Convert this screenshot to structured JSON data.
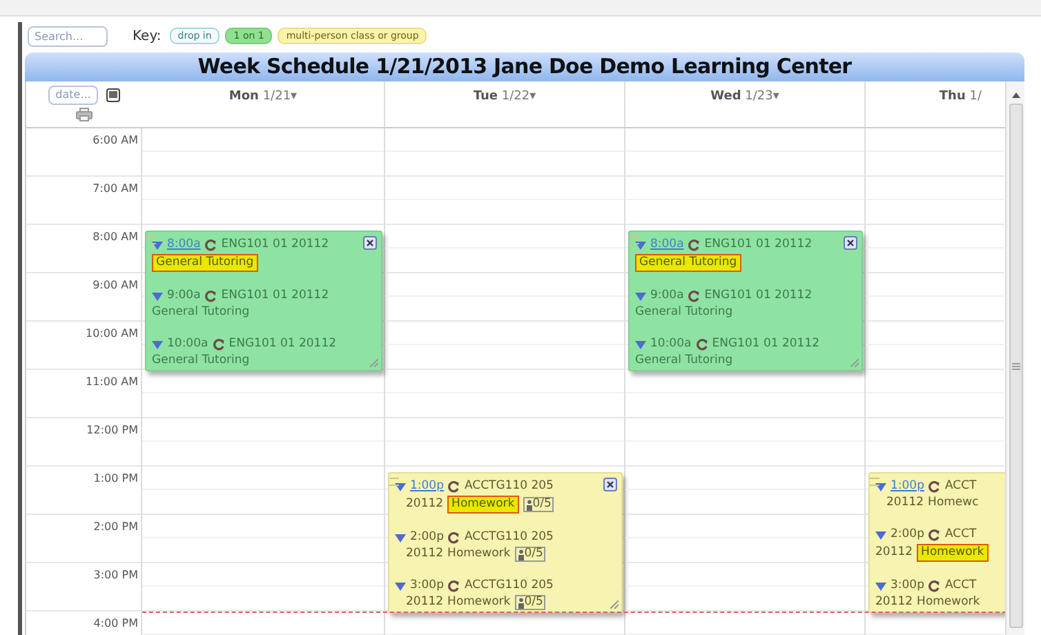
{
  "search": {
    "placeholder": "Search..."
  },
  "key": {
    "label": "Key:",
    "items": [
      {
        "kind": "drop_in",
        "label": "drop in"
      },
      {
        "kind": "one_on_one",
        "label": "1 on 1"
      },
      {
        "kind": "group",
        "label": "multi-person class or group"
      }
    ]
  },
  "title": "Week Schedule 1/21/2013 Jane Doe Demo Learning Center",
  "date_button": "date...",
  "hours": [
    "6:00 AM",
    "7:00 AM",
    "8:00 AM",
    "9:00 AM",
    "10:00 AM",
    "11:00 AM",
    "12:00 PM",
    "1:00 PM",
    "2:00 PM",
    "3:00 PM",
    "4:00 PM"
  ],
  "days": [
    {
      "name": "Mon",
      "date": "1/21",
      "caret": "▾",
      "blocks": [
        {
          "kind": "one_on_one",
          "closable": true,
          "entries": [
            {
              "time": "8:00a",
              "link": true,
              "course": "ENG101 01 20112",
              "description": "General Tutoring",
              "highlighted": true
            },
            {
              "time": "9:00a",
              "link": false,
              "course": "ENG101 01 20112",
              "description": "General Tutoring",
              "highlighted": false
            },
            {
              "time": "10:00a",
              "link": false,
              "course": "ENG101 01 20112",
              "description": "General Tutoring",
              "highlighted": false
            }
          ]
        }
      ]
    },
    {
      "name": "Tue",
      "date": "1/22",
      "caret": "▾",
      "blocks": [
        {
          "kind": "group",
          "closable": true,
          "entries": [
            {
              "time": "1:00p",
              "link": true,
              "course": "ACCTG110 205",
              "prefix": "20112",
              "description": "Homework",
              "highlighted": true,
              "capacity": "0/5"
            },
            {
              "time": "2:00p",
              "link": false,
              "course": "ACCTG110 205",
              "prefix": "20112",
              "description": "Homework",
              "highlighted": false,
              "capacity": "0/5"
            },
            {
              "time": "3:00p",
              "link": false,
              "course": "ACCTG110 205",
              "prefix": "20112",
              "description": "Homework",
              "highlighted": false,
              "capacity": "0/5"
            }
          ]
        }
      ]
    },
    {
      "name": "Wed",
      "date": "1/23",
      "caret": "▾",
      "blocks": [
        {
          "kind": "one_on_one",
          "closable": true,
          "entries": [
            {
              "time": "8:00a",
              "link": true,
              "course": "ENG101 01 20112",
              "description": "General Tutoring",
              "highlighted": true
            },
            {
              "time": "9:00a",
              "link": false,
              "course": "ENG101 01 20112",
              "description": "General Tutoring",
              "highlighted": false
            },
            {
              "time": "10:00a",
              "link": false,
              "course": "ENG101 01 20112",
              "description": "General Tutoring",
              "highlighted": false
            }
          ]
        }
      ]
    },
    {
      "name": "Thu",
      "date": "1/",
      "blocks": [
        {
          "kind": "group",
          "closable": false,
          "entries": [
            {
              "time": "1:00p",
              "link": true,
              "course": "ACCT",
              "prefix": "20112",
              "description": "Homewc",
              "highlighted": false
            },
            {
              "time": "2:00p",
              "link": false,
              "course": "ACCT",
              "prefix": "20112",
              "description": "Homework",
              "highlighted": true
            },
            {
              "time": "3:00p",
              "link": false,
              "course": "ACCT",
              "prefix": "20112",
              "description": "Homework",
              "highlighted": false
            }
          ]
        }
      ]
    }
  ]
}
